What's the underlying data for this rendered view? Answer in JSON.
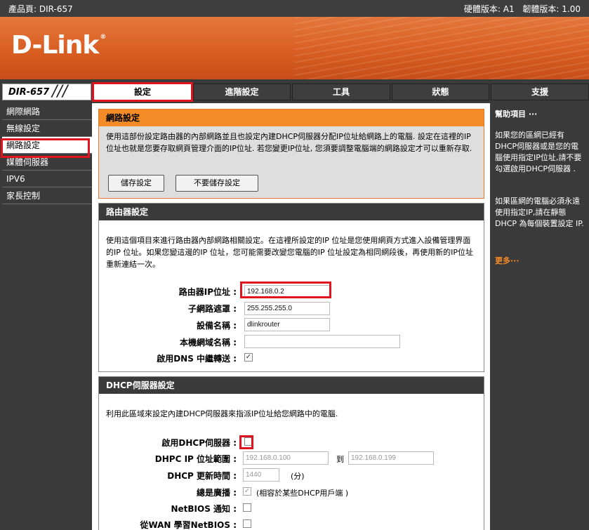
{
  "topbar": {
    "product": "產品頁: DIR-657",
    "hw": "硬體版本: A1",
    "fw": "韌體版本: 1.00"
  },
  "brand": {
    "logo": "D-Link",
    "reg": "®",
    "model": "DIR-657",
    "slash": "///"
  },
  "tabs": [
    "設定",
    "進階設定",
    "工具",
    "狀態",
    "支援"
  ],
  "sidebar": {
    "items": [
      "網際網路",
      "無線設定",
      "網路設定",
      "媒體伺服器",
      "IPV6",
      "家長控制"
    ]
  },
  "network": {
    "title": "網路設定",
    "desc": "使用這部份設定路由器的內部網路並且也設定內建DHCP伺服器分配IP位址給網路上的電腦. 設定在這裡的IP位址也就是您要存取網頁管理介面的IP位址. 若您變更IP位址, 您須要調整電腦端的網路設定才可以重新存取.",
    "save": "儲存設定",
    "dont_save": "不要儲存設定"
  },
  "router": {
    "title": "路由器設定",
    "desc": "使用這個項目來進行路由器內部網路相關設定。在這裡所設定的IP 位址是您使用網頁方式進入設備管理界面的IP 位址。如果您變這邊的IP 位址，您可能需要改變您電腦的IP 位址設定為相同網段後，再使用新的IP位址重新連結一次。",
    "ip_label": "路由器IP位址 :",
    "ip": "192.168.0.2",
    "mask_label": "子網路遮罩 :",
    "mask": "255.255.255.0",
    "device_label": "設備名稱 :",
    "device": "dlinkrouter",
    "domain_label": "本機網域名稱 :",
    "domain": "",
    "dns_label": "啟用DNS 中繼轉送 :",
    "dns": "✓"
  },
  "dhcp": {
    "title": "DHCP伺服器設定",
    "desc": "利用此區域來設定內建DHCP伺服器來指派IP位址給您網路中的電腦.",
    "enable_label": "啟用DHCP伺服器 :",
    "range_label": "DHPC IP 位址範圍 :",
    "range_start": "192.168.0.100",
    "to": "到",
    "range_end": "192.168.0.199",
    "lease_label": "DHCP 更新時間 :",
    "lease": "1440",
    "lease_unit": "(分)",
    "broadcast_label": "總是廣播 :",
    "broadcast": "✓",
    "broadcast_note": "(相容於某些DHCP用戶端 )",
    "netbios_label": "NetBIOS 通知 :",
    "wan_label": "從WAN 學習NetBIOS :"
  },
  "help": {
    "title": "幫助項目 ···",
    "p1": "如果您的區網已經有DHCP伺服器或是您的電腦使用指定IP位址,請不要勾選啟用DHCP伺服器 .",
    "p2": "如果區網的電腦必須永遠使用指定IP,請在靜態 DHCP 為每個裝置設定 IP.",
    "more": "更多···"
  },
  "colors": {
    "accent": "#f38b27",
    "highlight": "#e0141e",
    "dark": "#3a3a3a"
  }
}
